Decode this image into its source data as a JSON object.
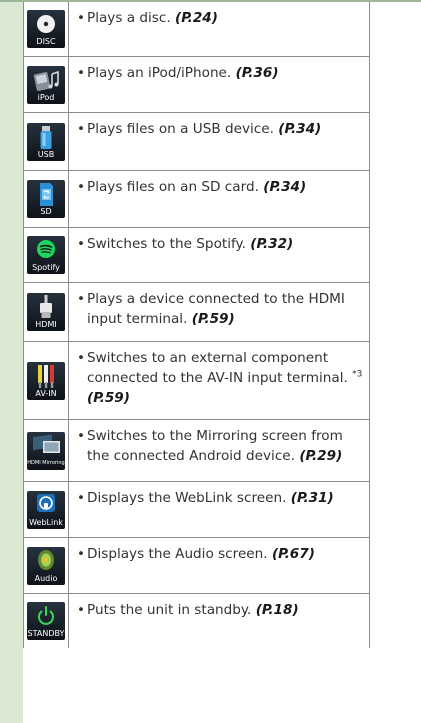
{
  "rows": [
    {
      "icon": "disc-icon",
      "icon_label": "DISC",
      "desc": "Plays a disc.",
      "ref": "(P.24)"
    },
    {
      "icon": "ipod-icon",
      "icon_label": "iPod",
      "desc": "Plays an iPod/iPhone.",
      "ref": "(P.36)"
    },
    {
      "icon": "usb-icon",
      "icon_label": "USB",
      "desc": "Plays files on a USB device.",
      "ref": "(P.34)"
    },
    {
      "icon": "sd-card-icon",
      "icon_label": "SD",
      "desc": "Plays files on an SD card.",
      "ref": "(P.34)"
    },
    {
      "icon": "spotify-icon",
      "icon_label": "Spotify",
      "desc": "Switches to the Spotify.",
      "ref": "(P.32)"
    },
    {
      "icon": "hdmi-icon",
      "icon_label": "HDMI",
      "desc": "Plays a device connected to the HDMI input terminal.",
      "ref": "(P.59)"
    },
    {
      "icon": "av-in-icon",
      "icon_label": "AV-IN",
      "desc": "Switches to an external component connected to the AV-IN input terminal.",
      "footnote": "*3",
      "ref": "(P.59)"
    },
    {
      "icon": "hdmi-mirroring-icon",
      "icon_label": "HDMI Mirroring",
      "desc": "Switches to the Mirroring screen from the connected Android device.",
      "ref": "(P.29)"
    },
    {
      "icon": "weblink-icon",
      "icon_label": "WebLink",
      "desc": "Displays the WebLink screen.",
      "ref": "(P.31)"
    },
    {
      "icon": "audio-icon",
      "icon_label": "Audio",
      "desc": "Displays the Audio screen.",
      "ref": "(P.67)"
    },
    {
      "icon": "standby-icon",
      "icon_label": "STANDBY",
      "desc": "Puts the unit in standby.",
      "ref": "(P.18)"
    }
  ],
  "bullet": "•",
  "colors": {
    "side_band": "#dbe8d2",
    "border": "#8c8c8c",
    "icon_bg": "#141b24"
  }
}
